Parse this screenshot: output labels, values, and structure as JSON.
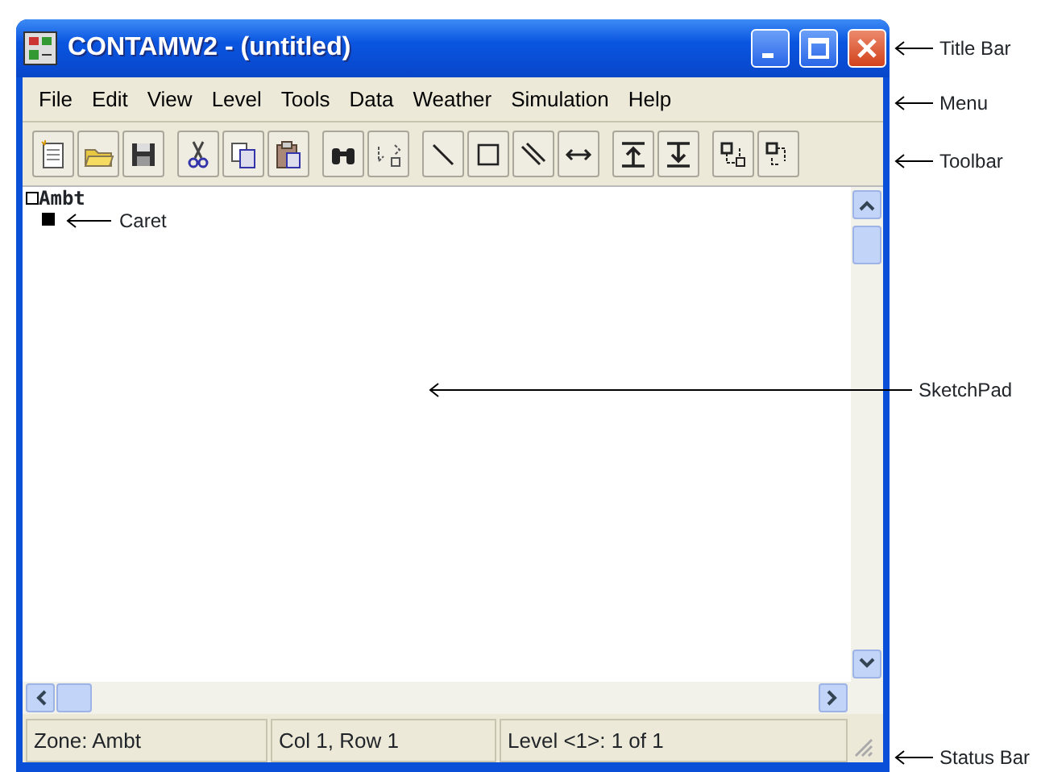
{
  "window": {
    "title": "CONTAMW2 - (untitled)"
  },
  "menu": [
    "File",
    "Edit",
    "View",
    "Level",
    "Tools",
    "Data",
    "Weather",
    "Simulation",
    "Help"
  ],
  "toolbar": [
    {
      "buttons": [
        {
          "kind": "new"
        },
        {
          "kind": "open"
        },
        {
          "kind": "save"
        }
      ]
    },
    {
      "buttons": [
        {
          "kind": "cut"
        },
        {
          "kind": "copy"
        },
        {
          "kind": "paste"
        }
      ]
    },
    {
      "buttons": [
        {
          "kind": "find"
        },
        {
          "kind": "rename"
        }
      ]
    },
    {
      "buttons": [
        {
          "kind": "line"
        },
        {
          "kind": "rect"
        },
        {
          "kind": "wall"
        },
        {
          "kind": "arrow"
        }
      ]
    },
    {
      "buttons": [
        {
          "kind": "up"
        },
        {
          "kind": "down"
        }
      ]
    },
    {
      "buttons": [
        {
          "kind": "swap1"
        },
        {
          "kind": "swap2"
        }
      ]
    }
  ],
  "sketchpad": {
    "zone_label": "Ambt",
    "caret_label": "Caret"
  },
  "status_bar": [
    "Zone: Ambt",
    "Col 1, Row 1",
    "Level <1>: 1 of 1"
  ],
  "annotations": [
    "Title Bar",
    "Menu",
    "Toolbar",
    "SketchPad",
    "Status Bar"
  ]
}
